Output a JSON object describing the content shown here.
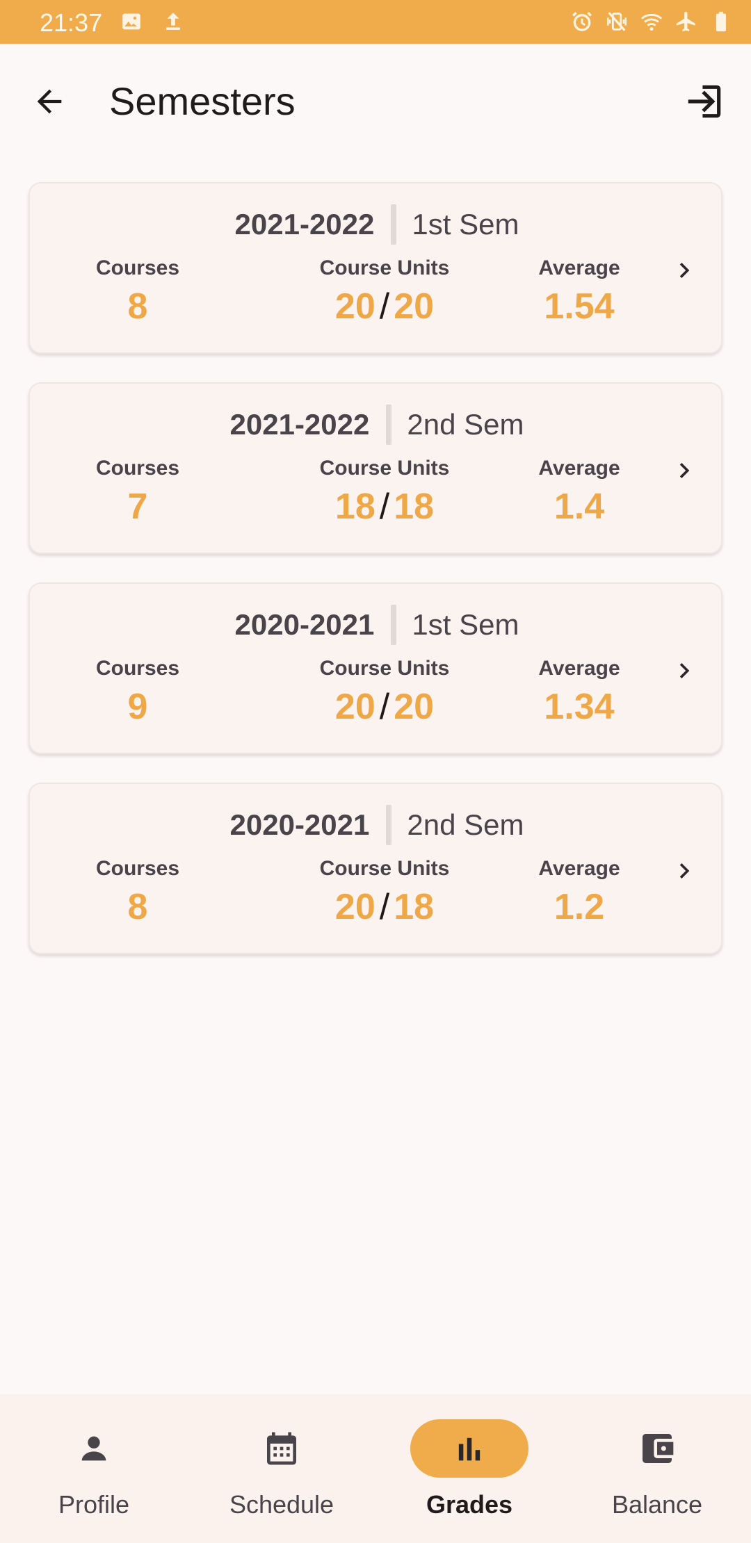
{
  "status_bar": {
    "time": "21:37",
    "left_icons": [
      "image-icon",
      "upload-icon"
    ],
    "right_icons": [
      "alarm-icon",
      "vibrate-off-icon",
      "wifi-icon",
      "airplane-icon",
      "battery-icon"
    ]
  },
  "app_bar": {
    "title": "Semesters",
    "back_icon": "arrow-back-icon",
    "logout_icon": "logout-icon"
  },
  "labels": {
    "courses": "Courses",
    "course_units": "Course Units",
    "average": "Average",
    "separator": "/"
  },
  "semesters": [
    {
      "year": "2021-2022",
      "sem": "1st Sem",
      "courses": "8",
      "units_taken": "20",
      "units_total": "20",
      "average": "1.54"
    },
    {
      "year": "2021-2022",
      "sem": "2nd Sem",
      "courses": "7",
      "units_taken": "18",
      "units_total": "18",
      "average": "1.4"
    },
    {
      "year": "2020-2021",
      "sem": "1st Sem",
      "courses": "9",
      "units_taken": "20",
      "units_total": "20",
      "average": "1.34"
    },
    {
      "year": "2020-2021",
      "sem": "2nd Sem",
      "courses": "8",
      "units_taken": "20",
      "units_total": "18",
      "average": "1.2"
    }
  ],
  "bottom_nav": [
    {
      "label": "Profile",
      "icon": "person-icon",
      "active": false
    },
    {
      "label": "Schedule",
      "icon": "calendar-icon",
      "active": false
    },
    {
      "label": "Grades",
      "icon": "bar-chart-icon",
      "active": true
    },
    {
      "label": "Balance",
      "icon": "wallet-icon",
      "active": false
    }
  ],
  "colors": {
    "accent": "#f0ac4a",
    "value": "#efa847",
    "card_bg": "#fbf3ef",
    "background": "#fdf8f8"
  }
}
